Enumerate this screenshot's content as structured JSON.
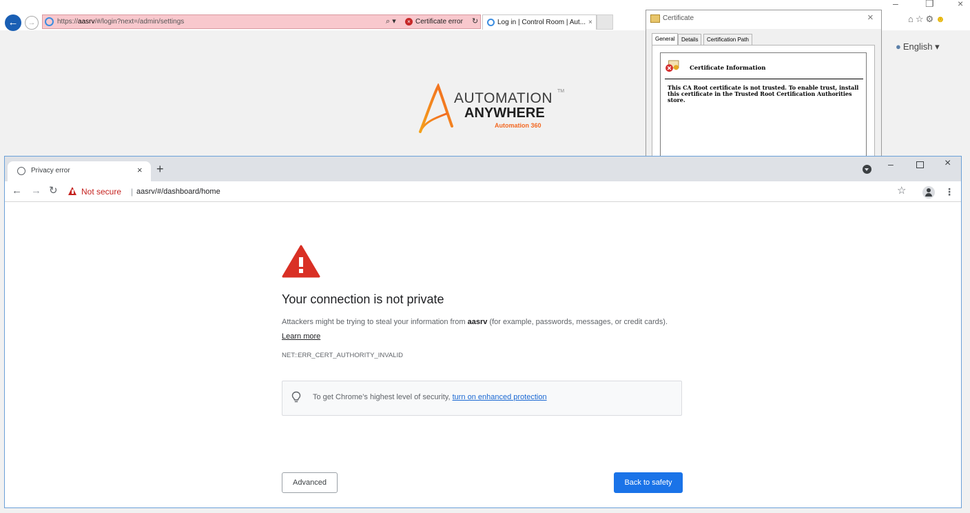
{
  "ie": {
    "url_prefix": "https://",
    "url_host": "aasrv",
    "url_rest": "/#/login?next=/admin/settings",
    "search_glyph": "⌕ ▾",
    "cert_error_label": "Certificate error",
    "refresh_glyph": "↻",
    "tab_title": "Log in | Control Room | Aut...",
    "tab_close": "×",
    "language_label": "English ▾",
    "icons": [
      "home-icon",
      "star-icon",
      "gear-icon",
      "smiley-icon"
    ]
  },
  "logo": {
    "word1": "AUTOMATION",
    "tm": "TM",
    "word2": "ANYWHERE",
    "word3": "Automation 360"
  },
  "certificate": {
    "title": "Certificate",
    "tabs": [
      "General",
      "Details",
      "Certification Path"
    ],
    "info_title": "Certificate Information",
    "message": "This CA Root certificate is not trusted. To enable trust, install this certificate in the Trusted Root Certification Authorities store."
  },
  "chrome": {
    "tab_title": "Privacy error",
    "tab_close": "×",
    "new_tab": "+",
    "not_secure": "Not secure",
    "separator": "|",
    "url": "aasrv/#/dashboard/home"
  },
  "interstitial": {
    "heading": "Your connection is not private",
    "desc_before": "Attackers might be trying to steal your information from ",
    "desc_host": "aasrv",
    "desc_after": " (for example, passwords, messages, or credit cards). ",
    "learn_more": "Learn more",
    "error_code": "NET::ERR_CERT_AUTHORITY_INVALID",
    "enhanced_text": "To get Chrome’s highest level of security, ",
    "enhanced_link": "turn on enhanced protection",
    "advanced_label": "Advanced",
    "back_label": "Back to safety"
  },
  "colors": {
    "primary_blue": "#1a73e8",
    "warning_red": "#d93025",
    "not_secure_red": "#c5221f",
    "ie_error_address": "#f8c8cd",
    "aa_orange": "#f26822"
  }
}
